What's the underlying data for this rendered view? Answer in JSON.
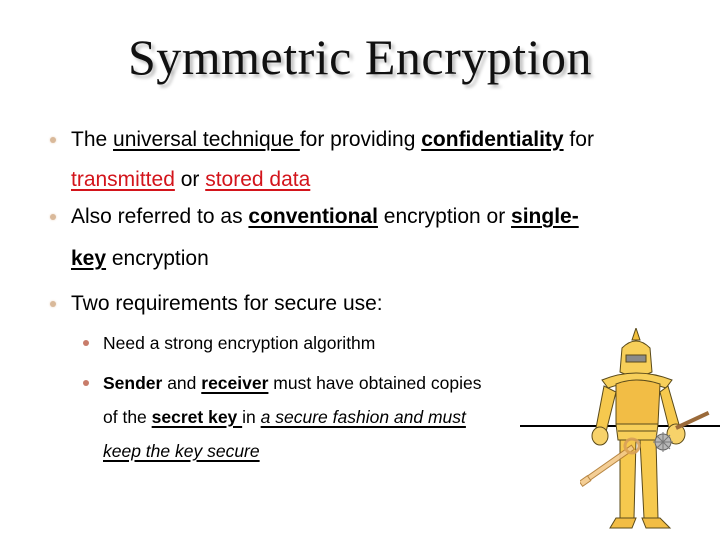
{
  "slide": {
    "title": "Symmetric Encryption",
    "bullets": [
      {
        "line1": {
          "t1": "The ",
          "t2": "universal technique ",
          "t3": "for providing ",
          "t4": "confidentiality",
          "t5": " for"
        },
        "line2": {
          "t1": "transmitted",
          "t2": " or ",
          "t3": "stored data"
        }
      },
      {
        "line1": {
          "t1": "Also referred to as ",
          "t2": "conventional",
          "t3": " encryption or ",
          "t4": "single-"
        },
        "line2": {
          "t1": "key",
          "t2": " encryption"
        }
      },
      {
        "line1": {
          "t1": "Two requirements for secure use:"
        },
        "sub_bullets": [
          {
            "t1": "Need a strong encryption algorithm"
          },
          {
            "line1": {
              "t1": "Sender",
              "t2": " and ",
              "t3": "receiver",
              "t4": " must have obtained copies"
            },
            "line2": {
              "t1": "of the ",
              "t2": "secret key ",
              "t3": "in ",
              "t4": "a secure fashion and must"
            },
            "line3": {
              "t1": "keep the key secure"
            }
          }
        ]
      }
    ],
    "illustration": "armored-knight-holding-key-and-mace",
    "colors": {
      "accent_red": "#d3141b",
      "bullet_level1": "#d9b99a",
      "bullet_level2": "#c87c6a",
      "knight_armor": "#f6c94e"
    }
  }
}
